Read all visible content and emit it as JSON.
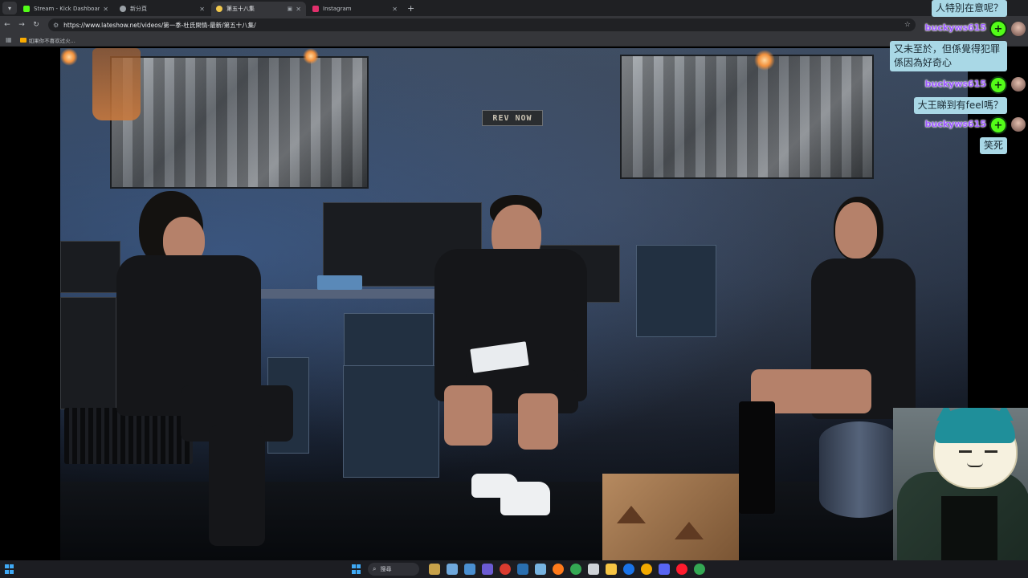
{
  "browser": {
    "tabs": [
      {
        "title": "Stream - Kick Dashboard",
        "favicon_color": "#53fc18",
        "active": false
      },
      {
        "title": "新分頁",
        "favicon_color": "#9aa0a6",
        "active": false
      },
      {
        "title": "第五十八集",
        "favicon_color": "#f2c94c",
        "active": true
      },
      {
        "title": "Instagram",
        "favicon_color": "#e1306c",
        "active": false
      }
    ],
    "url": "https://www.lateshow.net/videos/第一季-杜氏閑情-最新/第五十八集/",
    "bookmarks": [
      {
        "label": "如果你不喜欢过火..."
      }
    ]
  },
  "video": {
    "sign_text": "REV NOW"
  },
  "chat": {
    "username": "buckyws615",
    "messages": [
      {
        "text": "人特別在意呢？"
      },
      {
        "text": "又未至於，但係覺得犯罪係因為好奇心"
      },
      {
        "text": "大王睇到有feel嗎？"
      },
      {
        "text": "笑死"
      }
    ]
  },
  "taskbar": {
    "search_label": "搜尋",
    "apps": [
      "widgets-icon",
      "file-manager-icon",
      "edge-icon",
      "teams-icon",
      "chrome-icon",
      "steam-icon",
      "photos-icon",
      "firefox-icon",
      "chrome-icon",
      "capcut-icon",
      "explorer-icon",
      "chrome-icon",
      "coin-icon",
      "discord-icon",
      "opera-icon",
      "chrome-icon"
    ],
    "app_colors": [
      "#c8a24a",
      "#6fa8dc",
      "#4a8fd1",
      "#6b5bd3",
      "#d93b2f",
      "#2a6fb0",
      "#77b3e0",
      "#ff7a1a",
      "#34a853",
      "#cfd3d8",
      "#f7c544",
      "#1a73e8",
      "#f2a900",
      "#5865f2",
      "#ff1b2d",
      "#34a853"
    ]
  }
}
